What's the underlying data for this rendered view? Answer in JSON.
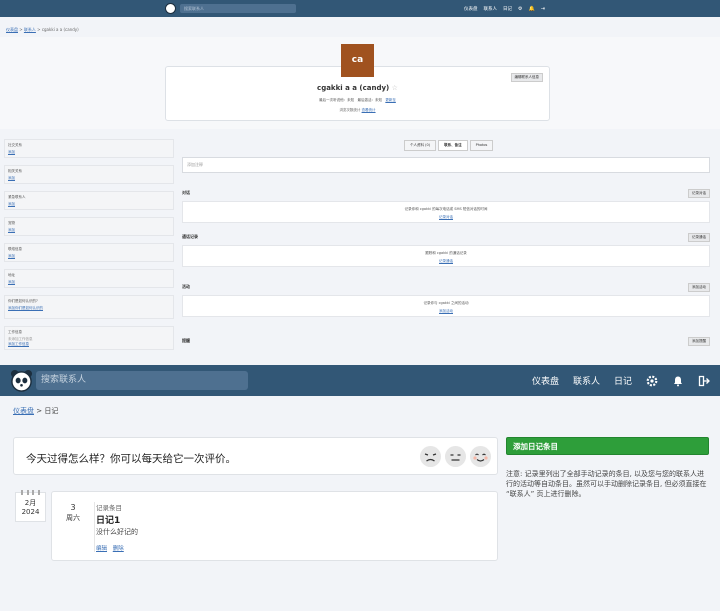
{
  "top_view": {
    "nav": {
      "search_placeholder": "搜索联系人",
      "links": [
        "仪表盘",
        "联系人",
        "日记"
      ]
    },
    "breadcrumb": {
      "dashboard": "仪表盘",
      "contacts": "联系人",
      "current": "cgakki a a (candy)"
    },
    "avatar_initials": "ca",
    "contact": {
      "name": "cgakki a a (candy)",
      "edit_label": "编辑联系人信息",
      "meta_1": "最后一次听说他：未知",
      "meta_2": "最后激活：未知",
      "meta_3_link": "更新至",
      "viewed_prefix": "浏览次数统计",
      "viewed_link": "查看统计"
    },
    "sidebar": [
      {
        "title": "社交关系",
        "link": "添加"
      },
      {
        "title": "相关关系",
        "link": "添加"
      },
      {
        "title": "紧急联系人",
        "link": "添加"
      },
      {
        "title": "宠物",
        "link": "添加"
      },
      {
        "title": "联络信息",
        "link": "添加"
      },
      {
        "title": "地址",
        "link": "添加"
      },
      {
        "title": "你们是如何认识的?",
        "link": "添加你们是如何认识的"
      },
      {
        "title": "工作信息",
        "note": "未添加工作信息",
        "link": "添加工作信息"
      }
    ],
    "tabs": [
      "个人资料 (0)",
      "联系、备注",
      "Photos"
    ],
    "note_placeholder": "添加注释",
    "sections": [
      {
        "title": "对话",
        "button": "记录对话",
        "body": "记录你和 cgakki 的每次电话或 SMS 短信对话的时间",
        "link": "记录对话"
      },
      {
        "title": "通话记录",
        "button": "记录通话",
        "body": "跟踪和 cgakki 的通话记录",
        "link": "记录通话"
      },
      {
        "title": "活动",
        "button": "添加活动",
        "body": "记录你与 cgakki 之间的活动",
        "link": "添加活动"
      },
      {
        "title": "提醒",
        "button": "添加提醒"
      }
    ]
  },
  "nav": {
    "search_placeholder": "搜索联系人",
    "dashboard": "仪表盘",
    "contacts": "联系人",
    "journal": "日记"
  },
  "breadcrumb": {
    "dashboard": "仪表盘",
    "separator": ">",
    "current": "日记"
  },
  "mood": {
    "question": "今天过得怎么样？你可以每天给它一次评价。"
  },
  "entry": {
    "month_year_month": "2月",
    "month_year_year": "2024",
    "day_number": "3",
    "weekday": "周六",
    "type": "记录条目",
    "title": "日记1",
    "body": "没什么好记的",
    "edit": "编辑",
    "delete": "删除"
  },
  "add_entry_label": "添加日记条目",
  "side_note": "注意: 记录里列出了全部手动记录的条目, 以及您与您的联系人进行的活动等自动条目。虽然可以手动删除记录条目, 但必须直接在 “联系人” 页上进行删除。",
  "colors": {
    "nav": "#325776",
    "add_button": "#2e9e3a",
    "avatar": "#a0521f"
  }
}
